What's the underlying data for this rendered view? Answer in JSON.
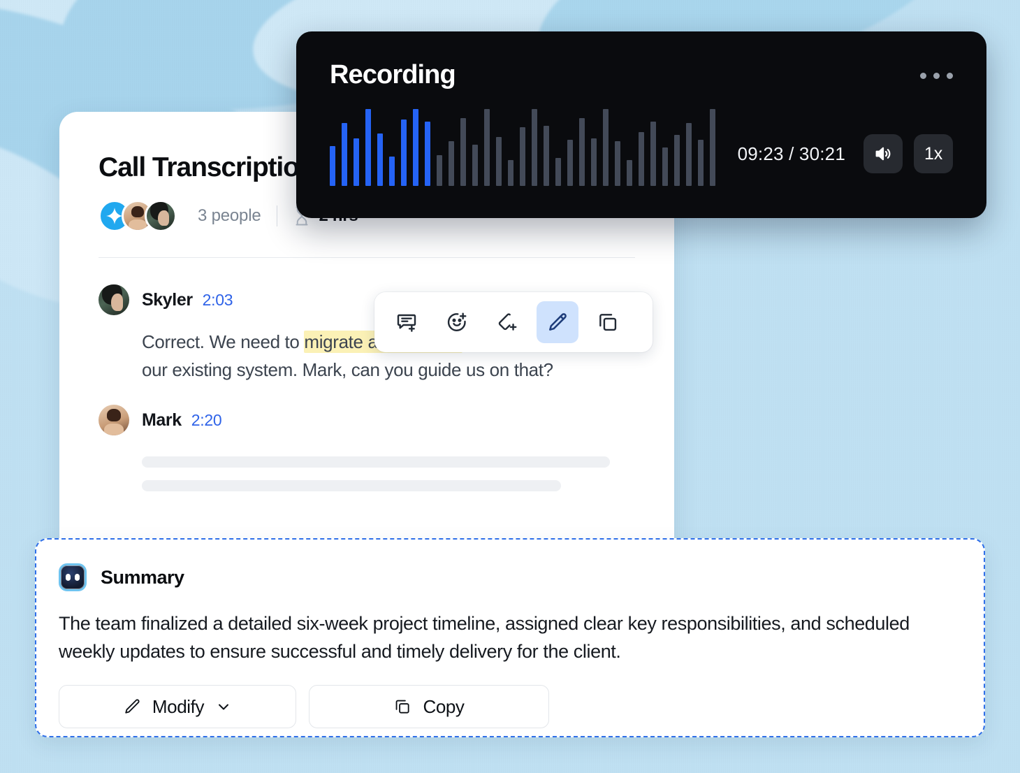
{
  "theme": {
    "page_bg": "#bfe0f2",
    "accent_blue": "#2563f5",
    "link_blue": "#2f63e8",
    "highlight_yellow": "#fbf1b6",
    "panel_black": "#0a0b0e",
    "waveform_active": "#2563f5",
    "waveform_inactive": "#434a58",
    "dashed_border": "#2f6fe8"
  },
  "transcript": {
    "title": "Call Transcription",
    "people_count": "3 people",
    "duration": "2 hrs",
    "hourglass_icon": "hourglass-icon",
    "avatars": [
      {
        "name": "ai-assistant-avatar",
        "icon": "sparkle-icon"
      },
      {
        "name": "mark-avatar"
      },
      {
        "name": "skyler-avatar"
      }
    ],
    "messages": [
      {
        "speaker": "Skyler",
        "time": "2:03",
        "text_before": "Correct. We need to ",
        "highlight": "migrate about 50GB",
        "text_after": " of data from our existing system. Mark, can you guide us on that?"
      },
      {
        "speaker": "Mark",
        "time": "2:20",
        "text_before": "",
        "highlight": "",
        "text_after": ""
      }
    ]
  },
  "toolbar": {
    "items": [
      {
        "name": "add-comment-icon",
        "label": "Add comment",
        "active": false
      },
      {
        "name": "add-reaction-icon",
        "label": "Add reaction",
        "active": false
      },
      {
        "name": "add-highlight-icon",
        "label": "Add highlight",
        "active": false
      },
      {
        "name": "edit-pen-icon",
        "label": "Edit",
        "active": true
      },
      {
        "name": "copy-icon",
        "label": "Copy",
        "active": false
      }
    ]
  },
  "recorder": {
    "title": "Recording",
    "menu_icon": "more-options-icon",
    "elapsed": "09:23",
    "total": "30:21",
    "time_display": "09:23 / 30:21",
    "volume_icon": "speaker-icon",
    "speed_label": "1x",
    "waveform": {
      "active_bar_count": 9,
      "total_bar_count": 33,
      "heights": [
        52,
        82,
        62,
        100,
        68,
        38,
        86,
        100,
        84,
        40,
        58,
        88,
        54,
        100,
        64,
        34,
        76,
        100,
        78,
        36,
        60,
        88,
        62,
        100,
        58,
        34,
        70,
        84,
        50,
        66,
        82,
        60,
        100
      ]
    }
  },
  "summary": {
    "icon": "ai-bot-icon",
    "title": "Summary",
    "text": "The team finalized a detailed six-week project timeline, assigned clear key responsibilities, and scheduled weekly updates to ensure successful and timely delivery for the client.",
    "actions": [
      {
        "name": "modify-button",
        "label": "Modify",
        "icon": "pen-icon",
        "caret": "chevron-down-icon"
      },
      {
        "name": "copy-button",
        "label": "Copy",
        "icon": "copy-icon"
      }
    ]
  }
}
